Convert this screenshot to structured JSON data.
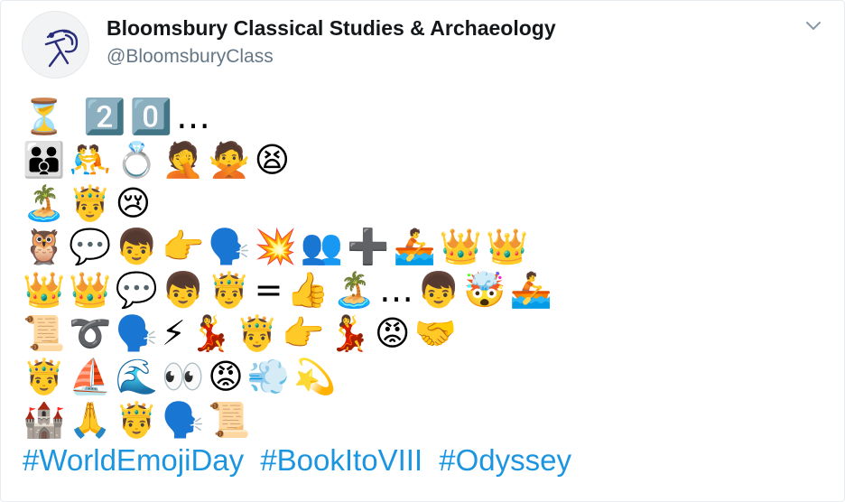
{
  "account": {
    "display_name": "Bloomsbury Classical Studies & Archaeology",
    "handle": "@BloomsburyClass"
  },
  "tweet": {
    "emoji_lines": [
      "⏳ 2️⃣0️⃣…",
      "👪🤼💍🤦🙅😫",
      "🏝️🤴😢",
      "🦉💬👦👉🗣️💥👥➕🚣👑👑",
      "👑👑💬👦🤴=👍🏝️…👦🤯🚣",
      "📜➰🗣️⚡💃🤴👉💃😡🤝",
      "🤴⛵🌊👀😡💨💫",
      "🏰🙏🤴🗣️📜"
    ],
    "hashtags": [
      "#WorldEmojiDay",
      "#BookItoVIII",
      "#Odyssey"
    ]
  },
  "icons": {
    "avatar": "logo-figure-icon",
    "menu": "chevron-down-icon"
  },
  "colors": {
    "link": "#1b95e0",
    "name": "#14171a",
    "handle": "#657786",
    "logo": "#2a2e7a"
  }
}
